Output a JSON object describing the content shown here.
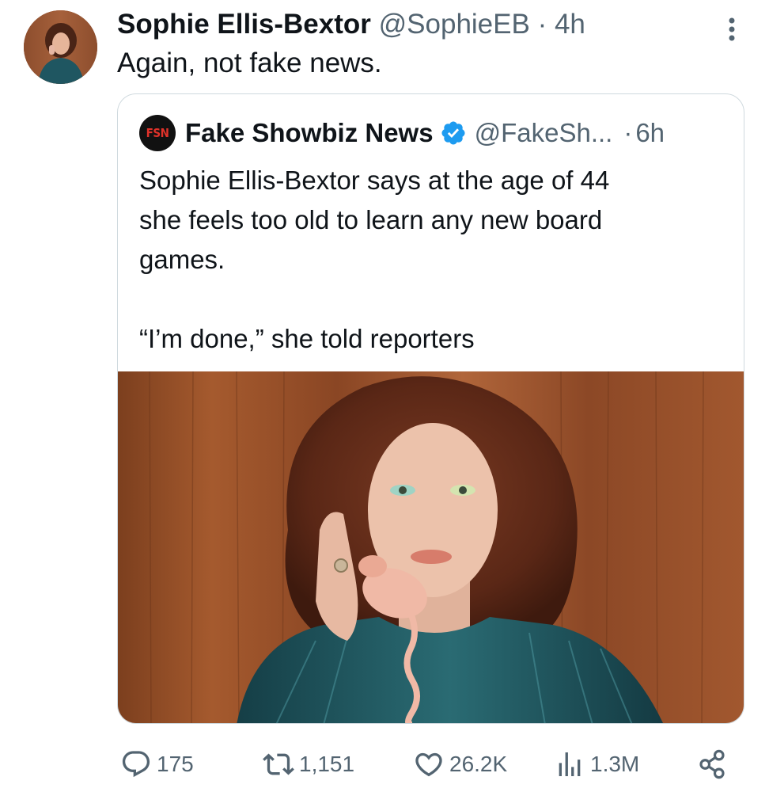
{
  "tweet": {
    "author_name": "Sophie Ellis-Bextor",
    "author_handle": "@SophieEB",
    "separator": "·",
    "time": "4h",
    "text": "Again, not fake news.",
    "avatar_icon": "profile-photo"
  },
  "quoted": {
    "avatar_text": "FSN",
    "name": "Fake Showbiz News",
    "verified": true,
    "verified_color": "#1d9bf0",
    "handle": "@FakeSh...",
    "separator": "·",
    "time": "6h",
    "text": "Sophie Ellis-Bextor says at the age of 44\nshe feels too old to learn any new board\ngames.\n\n“I’m done,” she told reporters",
    "image_description_icon": "photo"
  },
  "actions": {
    "replies": "175",
    "reposts": "1,151",
    "likes": "26.2K",
    "views": "1.3M"
  },
  "colors": {
    "text": "#0f1419",
    "secondary": "#536471",
    "border": "#cfd9de",
    "accent": "#1d9bf0"
  }
}
